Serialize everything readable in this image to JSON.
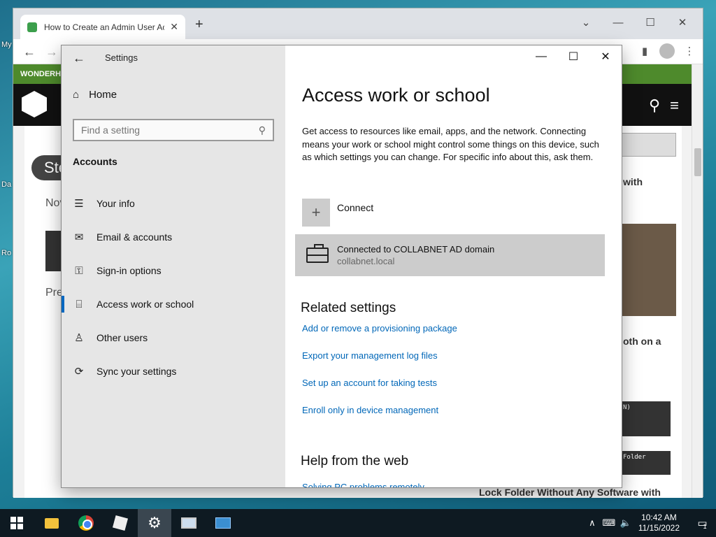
{
  "desktop": {
    "icon_labels": [
      "My",
      "Da",
      "Ro"
    ]
  },
  "browser": {
    "tab_title": "How to Create an Admin User Ac",
    "newtab_label": "+",
    "page": {
      "banner": "WONDERHO",
      "step_label": "Ste",
      "side_texts": [
        "Nov",
        "Pre"
      ],
      "right_snippets": [
        "with",
        "oth on a"
      ],
      "thumb_texts": [
        "N)",
        "Folder"
      ],
      "bottom_article": "Lock Folder Without Any Software with"
    }
  },
  "settings": {
    "window_title": "Settings",
    "sidebar": {
      "home_label": "Home",
      "search_placeholder": "Find a setting",
      "section": "Accounts",
      "items": [
        {
          "label": "Your info",
          "icon": "person-card-icon"
        },
        {
          "label": "Email & accounts",
          "icon": "mail-icon"
        },
        {
          "label": "Sign-in options",
          "icon": "key-icon"
        },
        {
          "label": "Access work or school",
          "icon": "briefcase-icon",
          "active": true
        },
        {
          "label": "Other users",
          "icon": "person-icon"
        },
        {
          "label": "Sync your settings",
          "icon": "sync-icon"
        }
      ]
    },
    "content": {
      "title": "Access work or school",
      "description": "Get access to resources like email, apps, and the network. Connecting means your work or school might control some things on this device, such as which settings you can change. For specific info about this, ask them.",
      "connect_label": "Connect",
      "account": {
        "name": "Connected to COLLABNET AD domain",
        "domain": "collabnet.local"
      },
      "related_heading": "Related settings",
      "related_links": [
        "Add or remove a provisioning package",
        "Export your management log files",
        "Set up an account for taking tests",
        "Enroll only in device management"
      ],
      "help_heading": "Help from the web",
      "help_links": [
        "Solving PC problems remotely"
      ]
    }
  },
  "taskbar": {
    "time": "10:42 AM",
    "date": "11/15/2022",
    "notification_count": "1"
  },
  "colors": {
    "accent": "#0067c0",
    "link": "#0067b8",
    "sidebar_bg": "#e6e6e6",
    "selected_item_bg": "#cccccc",
    "taskbar_bg": "#0e1a22"
  }
}
